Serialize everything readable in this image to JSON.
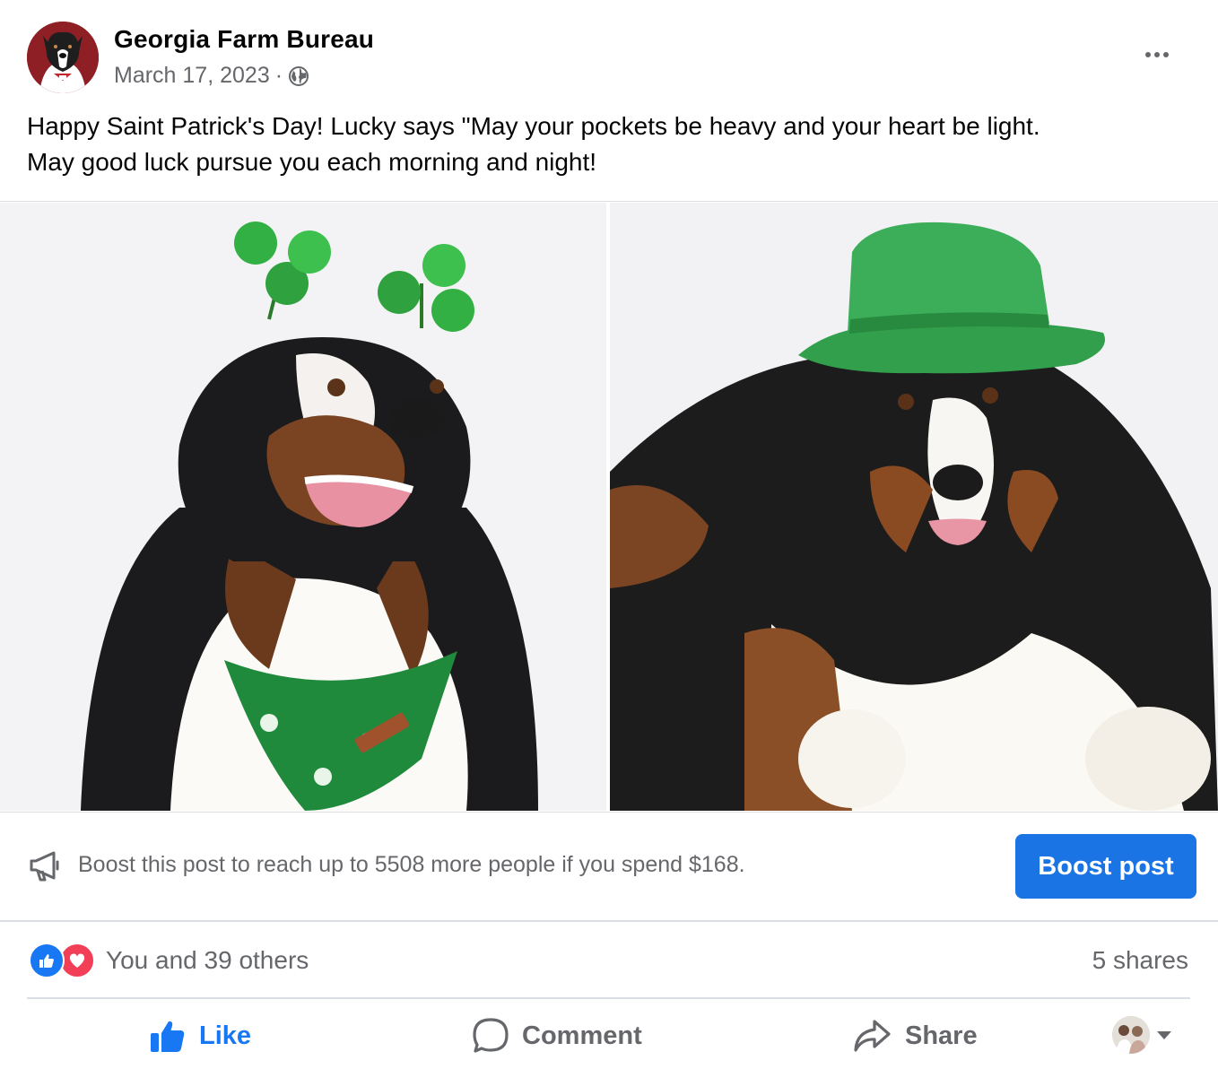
{
  "post": {
    "page_name": "Georgia Farm Bureau",
    "date": "March 17, 2023",
    "separator": "·",
    "audience_icon": "globe-icon",
    "text_line1": "Happy Saint Patrick's Day! Lucky says \"May your pockets be heavy and your heart be light.",
    "text_line2": "May good luck pursue you each morning and night!"
  },
  "photos": [
    {
      "icon": "photo-dog-shamrock-headband"
    },
    {
      "icon": "photo-dog-green-hat"
    }
  ],
  "boost": {
    "text": "Boost this post to reach up to 5508 more people if you spend $168.",
    "button_label": "Boost post",
    "accent": "#1b74e4"
  },
  "engagement": {
    "reactions_text": "You and 39 others",
    "shares_text": "5 shares",
    "reaction_icons": [
      "like-reaction-icon",
      "love-reaction-icon"
    ]
  },
  "actions": {
    "like": "Like",
    "comment": "Comment",
    "share": "Share"
  },
  "colors": {
    "like_blue": "#1877f2",
    "muted_text": "#65676b",
    "divider": "#dadde1"
  }
}
